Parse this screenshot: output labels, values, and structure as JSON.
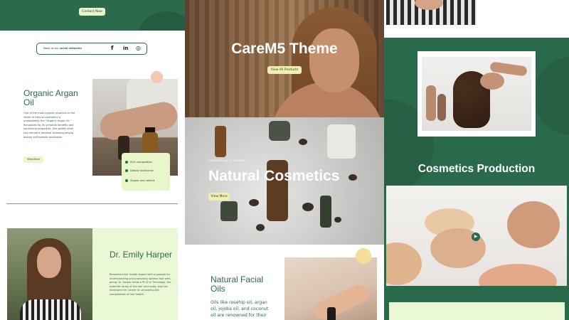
{
  "left": {
    "top_bar": {
      "contact_label": "Contact Now"
    },
    "social": {
      "prefix": "News on our",
      "highlight": "social networks",
      "icons": [
        "facebook-icon",
        "linkedin-icon",
        "instagram-icon"
      ],
      "facebook_glyph": "f",
      "linkedin_glyph": "in",
      "instagram_glyph": "◎"
    },
    "argan": {
      "title": "Organic Argan Oil",
      "description": "One of the most popular products in the realm of natural cosmetics is undoubtedly the \"Organic Argan Oil.\" Renowned for its versatile benefits and nourishing properties, this golden elixir has earned a devoted following among beauty enthusiasts worldwide.",
      "view_more": "View More",
      "features": [
        "Rich composition",
        "Deeply moisturize",
        "Supple and radiant"
      ]
    },
    "doctor": {
      "name": "Dr. Emily Harper",
      "description": "Renowned hair health expert with a passion for understanding and promoting optimal hair well-being. Dr. Harper holds a Ph.D in Trichology, the scientific study of the hair and scalp, and has dedicated her career to unraveling the complexities of hair health."
    }
  },
  "middle": {
    "hero": {
      "title": "CareM5 Theme",
      "button": "View All Products"
    },
    "cosmetics": {
      "kicker": "HARMONY WITH NATURE",
      "title": "Natural Cosmetics",
      "button": "View More"
    },
    "facial": {
      "title": "Natural Facial Oils",
      "description": "Oils like rosehip oil, argan oil, jojoba oil, and coconut oil are renowned for their"
    }
  },
  "right": {
    "production_title": "Cosmetics Production"
  },
  "colors": {
    "brand_green": "#2b6a4b",
    "light_green": "#eaf8d5",
    "button_yellow": "#f1eeb0",
    "peach": "#f2c7b4"
  }
}
